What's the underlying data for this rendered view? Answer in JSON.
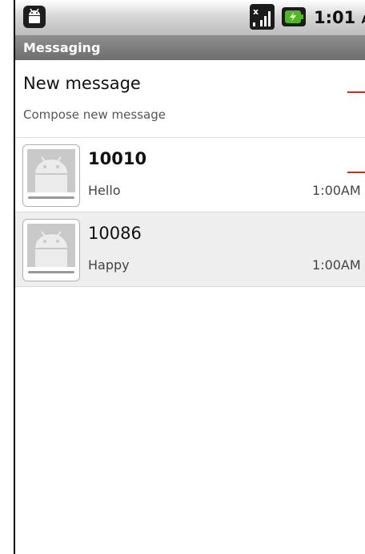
{
  "status_bar": {
    "app_icon": "android-notification-icon",
    "signal_icon": "signal-strength-icon",
    "battery_icon": "battery-charging-icon",
    "time": "1:01",
    "ampm": "AM"
  },
  "title_bar": {
    "title": "Messaging"
  },
  "new_message": {
    "title": "New message",
    "subtitle": "Compose new message"
  },
  "conversations": [
    {
      "name": "10010",
      "snippet": "Hello",
      "time": "1:00AM",
      "unread": true
    },
    {
      "name": "10086",
      "snippet": "Happy",
      "time": "1:00AM",
      "unread": false
    }
  ],
  "colors": {
    "title_bar": "#7a7a7a",
    "accent_red": "#e0241a",
    "read_row_bg": "#eeeeee"
  }
}
